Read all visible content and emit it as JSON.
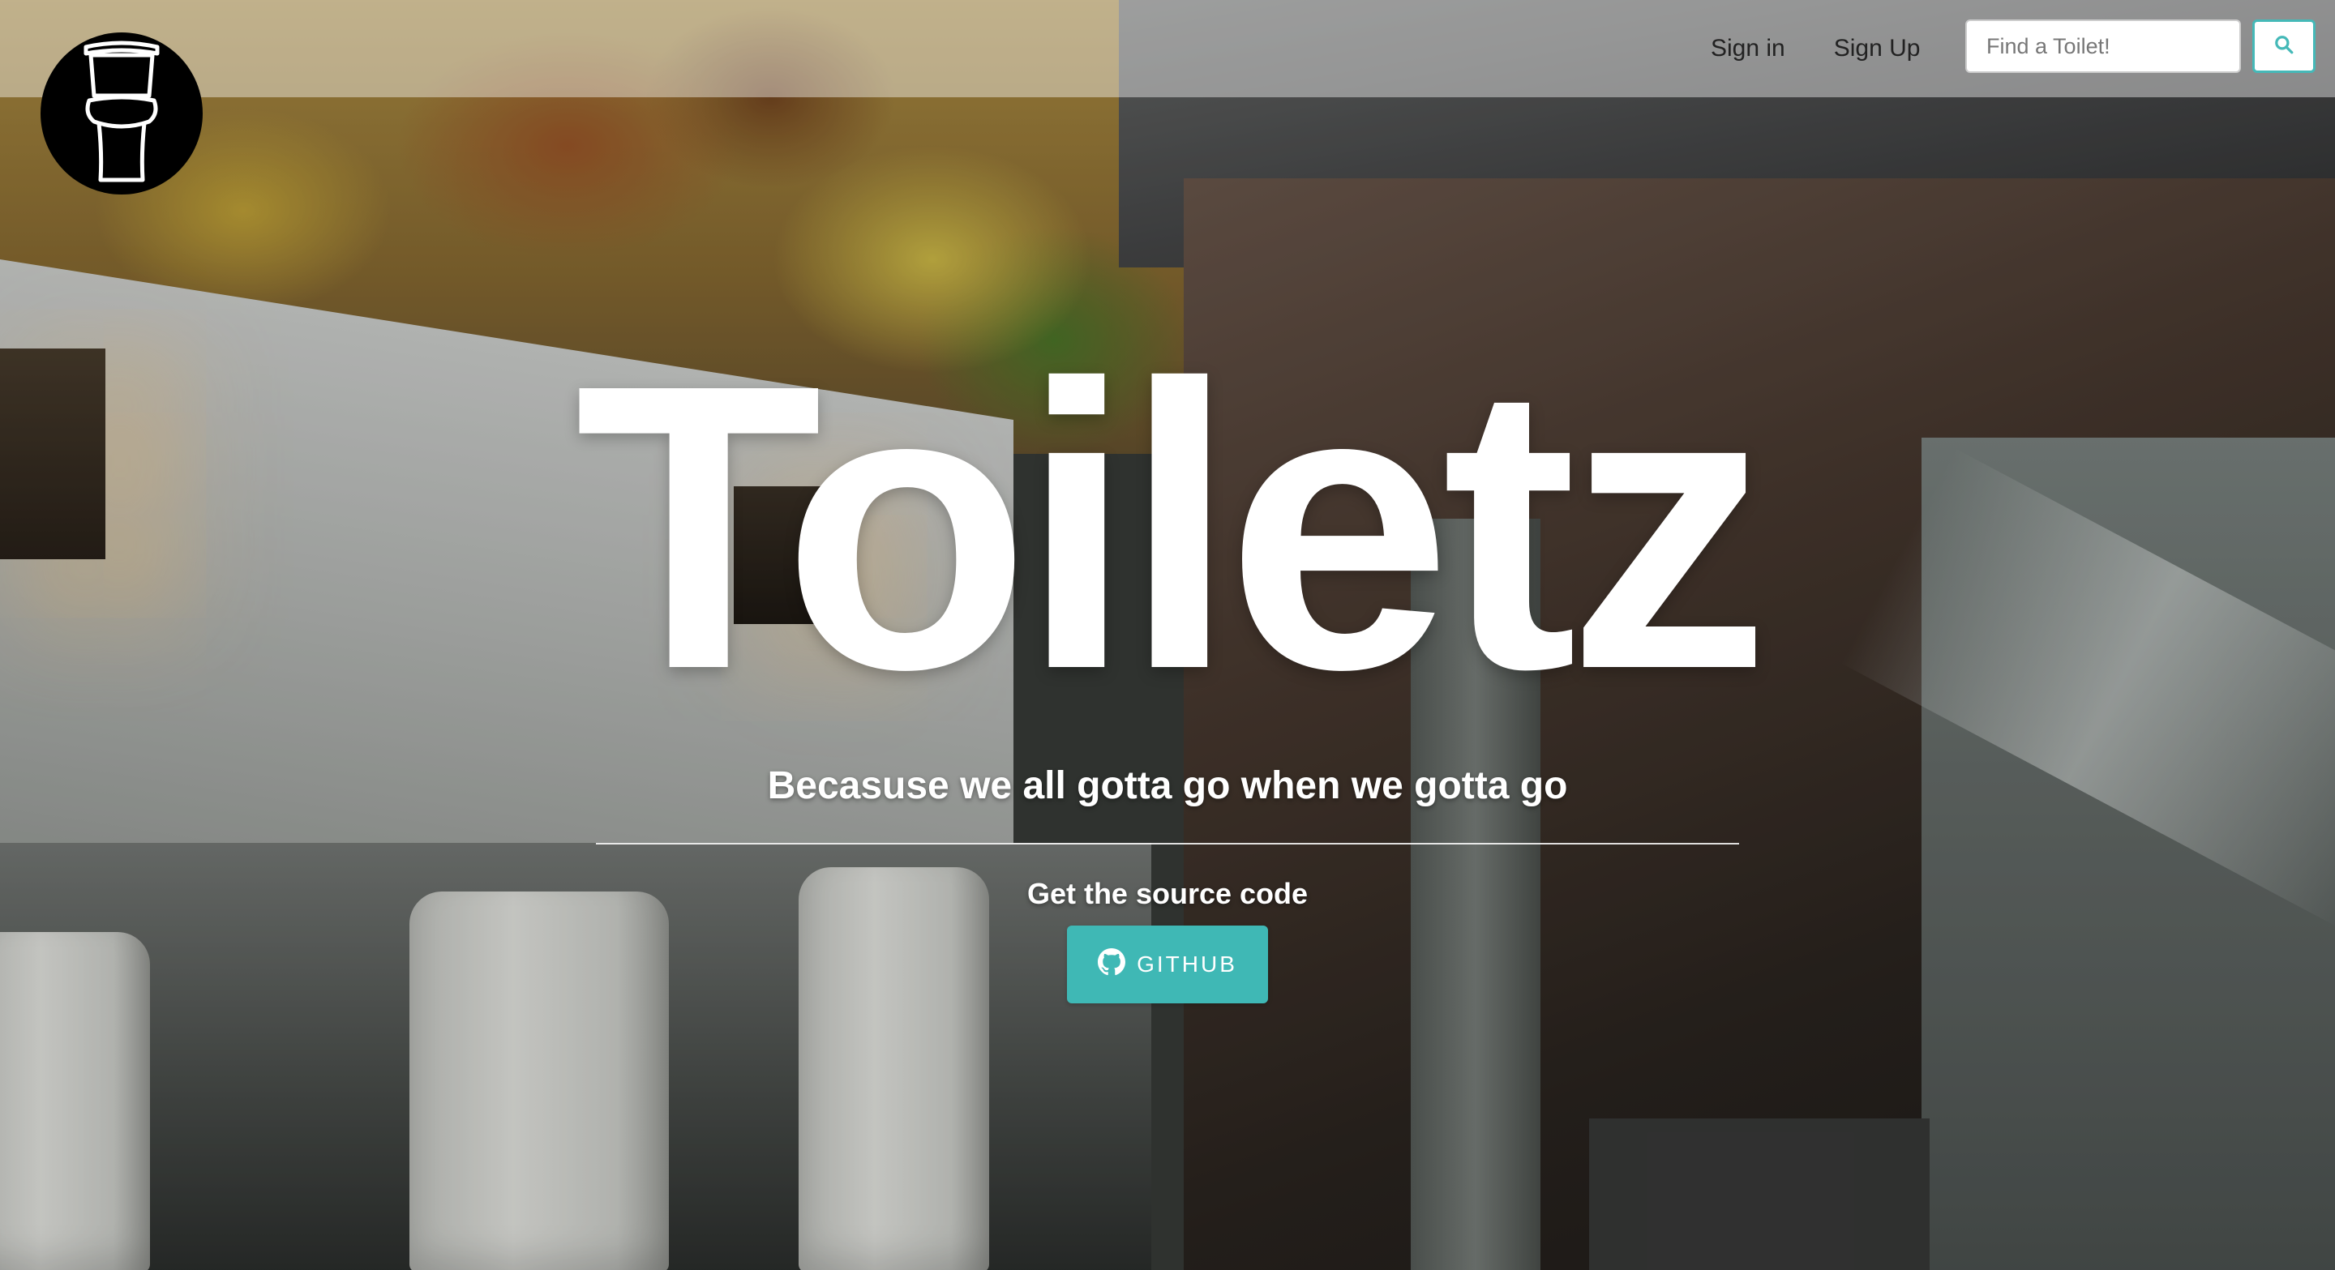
{
  "brand": {
    "logo_icon": "toilet-icon"
  },
  "nav": {
    "sign_in": "Sign in",
    "sign_up": "Sign Up"
  },
  "search": {
    "placeholder": "Find a Toilet!",
    "value": "",
    "button_icon": "search-icon"
  },
  "hero": {
    "title": "Toiletz",
    "subtitle": "Becasuse we all gotta go when we gotta go",
    "source_text": "Get the source code",
    "github_label": "GITHUB",
    "github_icon": "github-icon"
  },
  "colors": {
    "accent": "#3fb8b5",
    "navbar": "rgba(255,255,255,0.42)",
    "logo_bg": "#000000"
  }
}
